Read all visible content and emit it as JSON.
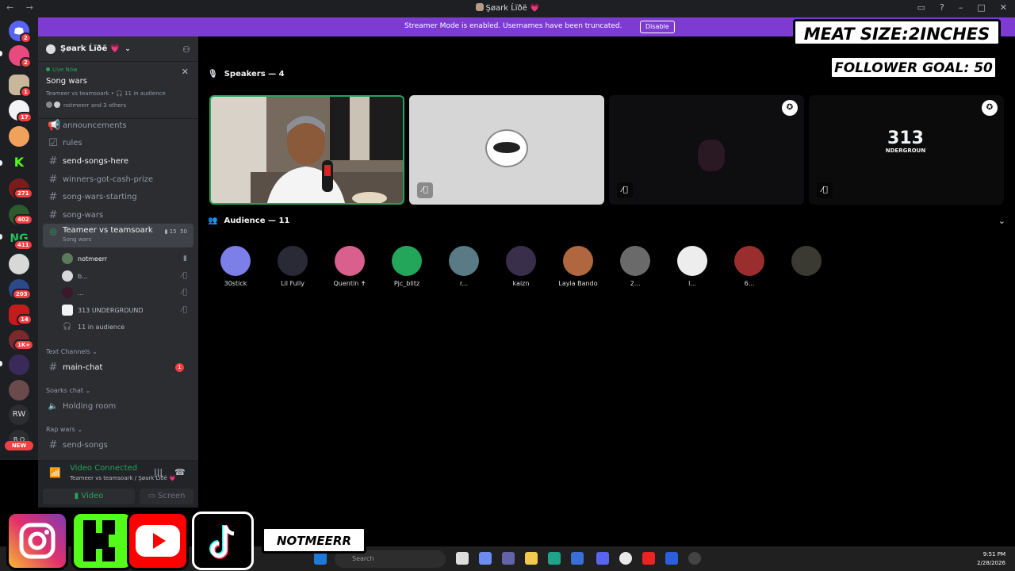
{
  "window": {
    "title": "Şøark Ĺïðë 💗",
    "nav": "←  →"
  },
  "banner": {
    "text": "Streamer Mode is enabled. Usernames have been truncated.",
    "button": "Disable"
  },
  "rail": {
    "badges": [
      "2",
      "2",
      "1",
      "17",
      "271",
      "402",
      "411",
      "203",
      "14",
      "1K+"
    ],
    "rw_label": "RW",
    "new_label": "NEW"
  },
  "guild": {
    "name": "Şøark Ĺïðë 💗",
    "live_label": "Live Now",
    "live_title": "Song wars",
    "live_sub": "Teameer vs teamsoark • 🎧 11 in audience",
    "live_avatars": "notmeerr and 3 others"
  },
  "channels": [
    {
      "name": "announcements",
      "icon": "megaphone-icon"
    },
    {
      "name": "rules",
      "icon": "checkbox-icon"
    },
    {
      "name": "send-songs-here",
      "icon": "hash"
    },
    {
      "name": "winners-got-cash-prize",
      "icon": "hash"
    },
    {
      "name": "song-wars-starting",
      "icon": "hash"
    },
    {
      "name": "song-wars",
      "icon": "hash"
    }
  ],
  "stage_channel": {
    "name": "Teameer vs teamsoark",
    "sub": "Song wars",
    "video_count": "15",
    "limit": "50",
    "members": [
      {
        "name": "notmeerr"
      },
      {
        "name": "b..."
      },
      {
        "name": "..."
      },
      {
        "name": "313 UNDERGROUND"
      }
    ],
    "audience": "11 in audience"
  },
  "categories": {
    "text": "Text Channels",
    "soarks": "Soarks chat",
    "rap": "Rap wars"
  },
  "main_chat": {
    "name": "main-chat",
    "badge": "1"
  },
  "holding_room": "Holding room",
  "send_songs": "send-songs",
  "voice": {
    "status": "Video Connected",
    "sub": "Teameer vs teamsoark / Şøark Ĺïðë 💗",
    "video_btn": "Video",
    "screen_btn": "Screen"
  },
  "speakers_header": "Speakers — 4",
  "audience_header": "Audience — 11",
  "tile4_text": "313\nNDERGROUN",
  "audience": [
    {
      "name": "30stick",
      "color": "#7d7fe8"
    },
    {
      "name": "Lil Fully",
      "color": "#2a2a36"
    },
    {
      "name": "Quentin ✝",
      "color": "#d9608d"
    },
    {
      "name": "Pjc_blitz",
      "color": "#23a55a"
    },
    {
      "name": "r...",
      "color": "#5a7a86"
    },
    {
      "name": "kaizn",
      "color": "#3a2f4a"
    },
    {
      "name": "Layla Bando",
      "color": "#b0663e"
    },
    {
      "name": "2...",
      "color": "#6a6a6a"
    },
    {
      "name": "l...",
      "color": "#ededed"
    },
    {
      "name": "6...",
      "color": "#9a2d2d"
    },
    {
      "name": "",
      "color": "#3a3a32"
    }
  ],
  "overlay": {
    "meat": "MEAT SIZE:2INCHES",
    "goal": "FOLLOWER GOAL: 50",
    "handle": "NOTMEERR"
  },
  "taskbar": {
    "search": "Search",
    "time": "9:51 PM",
    "date": "2/28/2026"
  }
}
